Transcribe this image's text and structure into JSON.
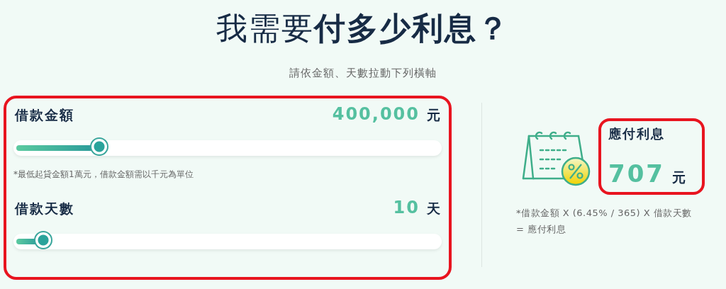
{
  "title": "我需要**付多少利息？**",
  "subtitle": "請依金額、天數拉動下列橫軸",
  "inputs_panel": {
    "highlighted": true,
    "sliders": [
      {
        "label": "借款金額",
        "value": "400,000",
        "unit": "元",
        "level": 0.2,
        "note": "*最低起貸金額1萬元，借款金額需以千元為單位"
      },
      {
        "label": "借款天數",
        "value": "10",
        "unit": "天",
        "level": 0.07
      }
    ]
  },
  "result": {
    "highlighted": true,
    "label": "應付利息",
    "value": "707",
    "unit": "元"
  },
  "formula": [
    "*借款金額 X (6.45% / 365) X 借款天數",
    "= 應付利息"
  ]
}
